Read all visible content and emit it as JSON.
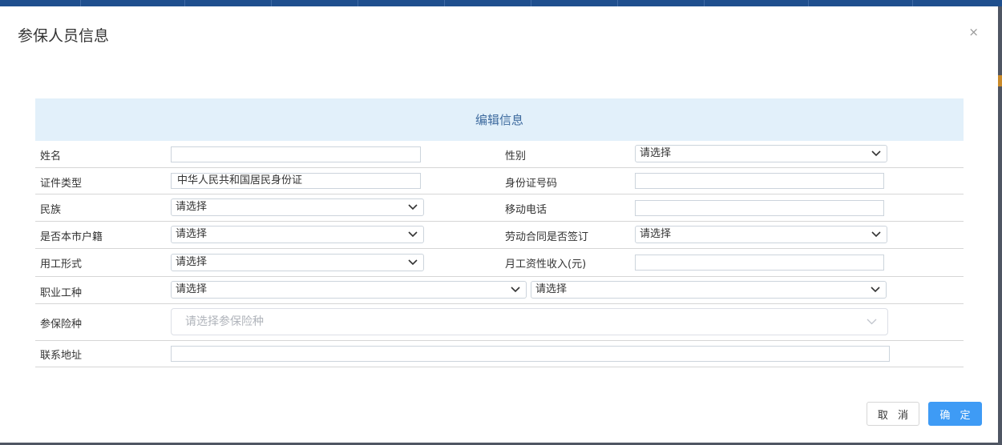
{
  "dialog": {
    "title": "参保人员信息",
    "close": "×",
    "section_header": "编辑信息"
  },
  "fields": {
    "name": {
      "label": "姓名",
      "value": ""
    },
    "gender": {
      "label": "性别",
      "value": "请选择"
    },
    "id_type": {
      "label": "证件类型",
      "value": "中华人民共和国居民身份证"
    },
    "id_number": {
      "label": "身份证号码",
      "value": ""
    },
    "ethnicity": {
      "label": "民族",
      "value": "请选择"
    },
    "mobile": {
      "label": "移动电话",
      "value": ""
    },
    "local_hukou": {
      "label": "是否本市户籍",
      "value": "请选择"
    },
    "labor_contract": {
      "label": "劳动合同是否签订",
      "value": "请选择"
    },
    "employment_form": {
      "label": "用工形式",
      "value": "请选择"
    },
    "monthly_income": {
      "label": "月工资性收入(元)",
      "value": ""
    },
    "occupation": {
      "label": "职业工种",
      "value1": "请选择",
      "value2": "请选择"
    },
    "insurance_types": {
      "label": "参保险种",
      "placeholder": "请选择参保险种"
    },
    "address": {
      "label": "联系地址",
      "value": ""
    }
  },
  "buttons": {
    "cancel": "取 消",
    "ok": "确 定"
  },
  "colors": {
    "header_bg": "#e2f0fa",
    "header_text": "#3d6a9e",
    "primary": "#3e9bf5"
  }
}
